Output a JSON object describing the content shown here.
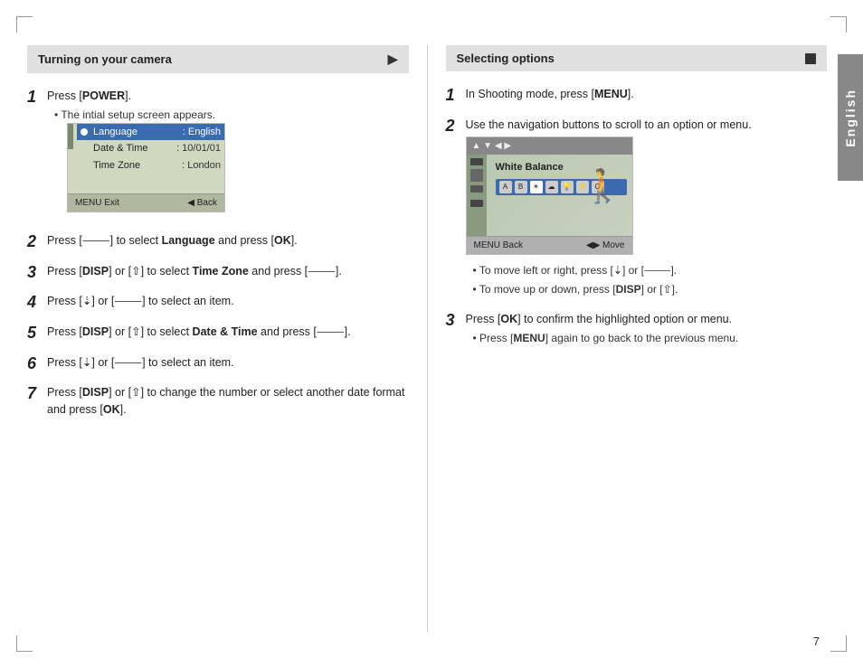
{
  "page": {
    "number": "7",
    "side_tab": "English"
  },
  "left_section": {
    "header": "Turning on your camera",
    "steps": [
      {
        "num": "1",
        "main": "Press [POWER].",
        "sub": "The intial setup screen appears.",
        "has_screen": true
      },
      {
        "num": "2",
        "main": "Press [dial] to select Language and press [OK].",
        "has_screen": false
      },
      {
        "num": "3",
        "main": "Press [DISP] or [up] to select Time Zone and press [dial].",
        "has_screen": false
      },
      {
        "num": "4",
        "main": "Press [left] or [dial] to select an item.",
        "has_screen": false
      },
      {
        "num": "5",
        "main": "Press [DISP] or [up] to select Date & Time and press [dial].",
        "has_screen": false
      },
      {
        "num": "6",
        "main": "Press [left] or [dial] to select an item.",
        "has_screen": false
      },
      {
        "num": "7",
        "main": "Press [DISP] or [up] to change the number or select another date format and press [OK].",
        "has_screen": false
      }
    ],
    "camera_menu": {
      "rows": [
        {
          "label": "Language",
          "value": ": English",
          "selected": true
        },
        {
          "label": "Date & Time",
          "value": ": 10/01/01",
          "selected": false
        },
        {
          "label": "Time Zone",
          "value": ": London",
          "selected": false
        }
      ],
      "footer_left": "MENU Exit",
      "footer_right": "◄ Back"
    }
  },
  "right_section": {
    "header": "Selecting options",
    "steps": [
      {
        "num": "1",
        "main": "In Shooting mode, press [MENU].",
        "has_screen": false
      },
      {
        "num": "2",
        "main": "Use the navigation buttons to scroll to an option or menu.",
        "has_screen": true,
        "bullets": [
          "To move left or right, press [left] or [dial].",
          "To move up or down, press [DISP] or [up]."
        ]
      },
      {
        "num": "3",
        "main": "Press [OK] to confirm the highlighted option or menu.",
        "sub": "Press [MENU] again to go back to the previous menu.",
        "has_screen": false
      }
    ],
    "wb_screen": {
      "label": "White Balance",
      "footer_left": "MENU Back",
      "footer_right": "◄► Move"
    }
  }
}
